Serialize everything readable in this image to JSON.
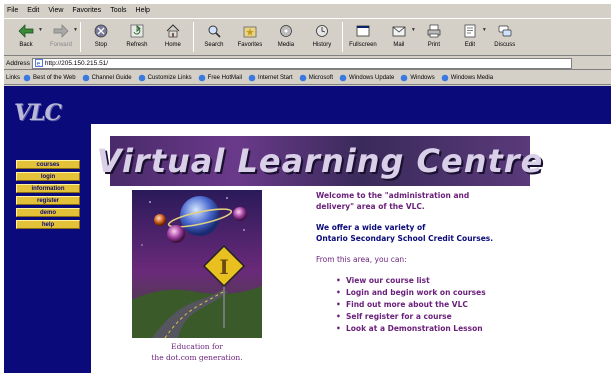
{
  "menu": [
    "File",
    "Edit",
    "View",
    "Favorites",
    "Tools",
    "Help"
  ],
  "toolbar": [
    {
      "label": "Back",
      "icon": "back-arrow-icon",
      "enabled": true
    },
    {
      "label": "Forward",
      "icon": "forward-arrow-icon",
      "enabled": false
    },
    {
      "label": "Stop",
      "icon": "stop-icon",
      "enabled": true
    },
    {
      "label": "Refresh",
      "icon": "refresh-icon",
      "enabled": true
    },
    {
      "label": "Home",
      "icon": "home-icon",
      "enabled": true
    },
    {
      "label": "Search",
      "icon": "search-icon",
      "enabled": true
    },
    {
      "label": "Favorites",
      "icon": "favorites-icon",
      "enabled": true
    },
    {
      "label": "Media",
      "icon": "media-icon",
      "enabled": true
    },
    {
      "label": "History",
      "icon": "history-icon",
      "enabled": true
    },
    {
      "label": "Fullscreen",
      "icon": "fullscreen-icon",
      "enabled": true
    },
    {
      "label": "Mail",
      "icon": "mail-icon",
      "enabled": true
    },
    {
      "label": "Print",
      "icon": "print-icon",
      "enabled": true
    },
    {
      "label": "Edit",
      "icon": "edit-icon",
      "enabled": true
    },
    {
      "label": "Discuss",
      "icon": "discuss-icon",
      "enabled": true
    }
  ],
  "address": {
    "label": "Address",
    "url": "http://205.150.215.51/"
  },
  "links": {
    "label": "Links",
    "items": [
      "Best of the Web",
      "Channel Guide",
      "Customize Links",
      "Free HotMail",
      "Internet Start",
      "Microsoft",
      "Windows Update",
      "Windows",
      "Windows Media"
    ]
  },
  "page": {
    "logo": "VLC",
    "banner_title": "Virtual Learning Centre",
    "nav": [
      "courses",
      "login",
      "information",
      "register",
      "demo",
      "help"
    ],
    "caption_line1": "Education for",
    "caption_line2": "the dot.com generation.",
    "welcome_line1": "Welcome to the \"administration and",
    "welcome_line2": "delivery\" area of the VLC.",
    "offer_line1": "We offer a wide variety of",
    "offer_line2": "Ontario Secondary School Credit Courses.",
    "from_text": "From this area, you can:",
    "bullets": [
      "View our course list",
      "Login and begin work on courses",
      "Find out more about the VLC",
      "Self register for a course",
      "Look at a Demonstration Lesson"
    ],
    "sign_glyph": "I"
  },
  "colors": {
    "navy": "#0a0a7a",
    "purple": "#6a1f7a",
    "gold": "#e3c23a",
    "chrome": "#d4d0c8"
  }
}
